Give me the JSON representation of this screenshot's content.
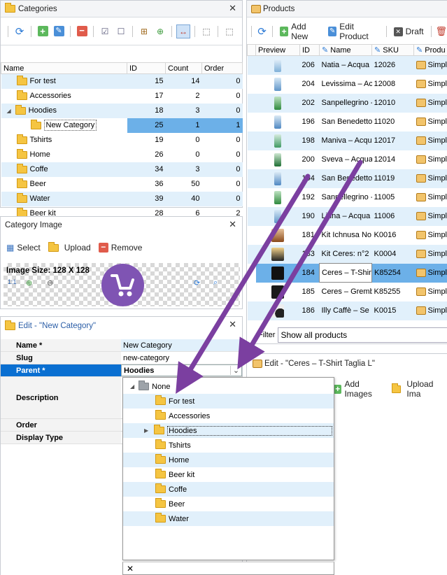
{
  "categories": {
    "title": "Categories",
    "columns": [
      "Name",
      "ID",
      "Count",
      "Order"
    ],
    "rows": [
      {
        "name": "For test",
        "id": "15",
        "count": "14",
        "order": "0"
      },
      {
        "name": "Accessories",
        "id": "17",
        "count": "2",
        "order": "0"
      },
      {
        "name": "Hoodies",
        "id": "18",
        "count": "3",
        "order": "0"
      },
      {
        "name": "New Category",
        "id": "25",
        "count": "1",
        "order": "1"
      },
      {
        "name": "Tshirts",
        "id": "19",
        "count": "0",
        "order": "0"
      },
      {
        "name": "Home",
        "id": "26",
        "count": "0",
        "order": "0"
      },
      {
        "name": "Coffe",
        "id": "34",
        "count": "3",
        "order": "0"
      },
      {
        "name": "Beer",
        "id": "36",
        "count": "50",
        "order": "0"
      },
      {
        "name": "Water",
        "id": "39",
        "count": "40",
        "order": "0"
      },
      {
        "name": "Beer kit",
        "id": "28",
        "count": "6",
        "order": "2"
      }
    ]
  },
  "category_image": {
    "title": "Category Image",
    "select_label": "Select",
    "upload_label": "Upload",
    "remove_label": "Remove",
    "image_size_label": "Image Size: 128 X 128",
    "zoom_reset_label": "1:1"
  },
  "edit_category": {
    "title": "Edit - \"New Category\"",
    "props": [
      {
        "key": "Name *",
        "value": "New Category"
      },
      {
        "key": "Slug",
        "value": "new-category"
      },
      {
        "key": "Parent *",
        "value": "Hoodies"
      },
      {
        "key": "Description",
        "value": ""
      },
      {
        "key": "Order",
        "value": ""
      },
      {
        "key": "Display Type",
        "value": ""
      }
    ]
  },
  "parent_dropdown": {
    "root": "None",
    "items": [
      "For test",
      "Accessories",
      "Hoodies",
      "Tshirts",
      "Home",
      "Beer kit",
      "Coffe",
      "Beer",
      "Water"
    ]
  },
  "products": {
    "title": "Products",
    "add_new_label": "Add New",
    "edit_product_label": "Edit Product",
    "draft_label": "Draft",
    "columns": [
      "Preview",
      "ID",
      "Name",
      "SKU",
      "Produ"
    ],
    "rows": [
      {
        "id": "206",
        "name": "Natia – Acqua",
        "sku": "12026",
        "type": "Simpl"
      },
      {
        "id": "204",
        "name": "Levissima – Ac",
        "sku": "12008",
        "type": "Simpl"
      },
      {
        "id": "202",
        "name": "Sanpellegrino -",
        "sku": "12010",
        "type": "Simpl"
      },
      {
        "id": "196",
        "name": "San Benedetto",
        "sku": "11020",
        "type": "Simpl"
      },
      {
        "id": "198",
        "name": "Maniva – Acqu",
        "sku": "12017",
        "type": "Simpl"
      },
      {
        "id": "200",
        "name": "Sveva – Acqua",
        "sku": "12014",
        "type": "Simpl"
      },
      {
        "id": "194",
        "name": "San Benedetto",
        "sku": "11019",
        "type": "Simpl"
      },
      {
        "id": "192",
        "name": "Sanpellegrino -",
        "sku": "11005",
        "type": "Simpl"
      },
      {
        "id": "190",
        "name": "Linna – Acqua",
        "sku": "11006",
        "type": "Simpl"
      },
      {
        "id": "181",
        "name": "Kit Ichnusa No",
        "sku": "K0016",
        "type": "Simpl"
      },
      {
        "id": "183",
        "name": "Kit Ceres: n°2",
        "sku": "K0004",
        "type": "Simpl"
      },
      {
        "id": "184",
        "name": "Ceres – T-Shirt",
        "sku": "K85254",
        "type": "Simpl"
      },
      {
        "id": "185",
        "name": "Ceres – Gremb",
        "sku": "K85255",
        "type": "Simpl"
      },
      {
        "id": "186",
        "name": "Illy Caffè – Se",
        "sku": "K0015",
        "type": "Simpl"
      }
    ],
    "filter_label": "Filter",
    "filter_value": "Show all products"
  },
  "edit_product": {
    "title": "Edit - \"Ceres – T-Shirt Taglia L\"",
    "add_images_label": "Add Images",
    "upload_images_label": "Upload Ima"
  },
  "colors": {
    "accent": "#6cb0e8",
    "alt_row": "#e1f0fb",
    "selected_prop": "#0a6fd1",
    "arrow": "#7b3fa0",
    "logo": "#7f54b3"
  }
}
